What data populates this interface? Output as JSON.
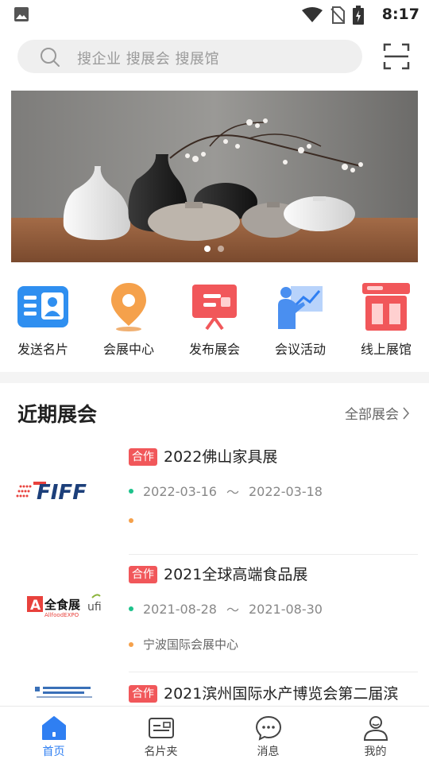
{
  "status_bar": {
    "time": "8:17"
  },
  "search": {
    "placeholder": "搜企业 搜展会 搜展馆"
  },
  "banner": {
    "slide_count": 2,
    "active_slide": 1
  },
  "quick_menu": [
    {
      "label": "发送名片",
      "icon": "business-card-icon",
      "color": "#2f8ff0"
    },
    {
      "label": "会展中心",
      "icon": "location-pin-icon",
      "color": "#f5a14b"
    },
    {
      "label": "发布展会",
      "icon": "publish-board-icon",
      "color": "#f1575a"
    },
    {
      "label": "会议活动",
      "icon": "presentation-icon",
      "color": "#4a8ff0"
    },
    {
      "label": "线上展馆",
      "icon": "online-hall-icon",
      "color": "#f1575a"
    }
  ],
  "section": {
    "title": "近期展会",
    "more": "全部展会"
  },
  "expos": [
    {
      "tag": "合作",
      "name": "2022佛山家具展",
      "start": "2022-03-16",
      "sep": "～",
      "end": "2022-03-18",
      "venue": "",
      "logo_text": "FIFF"
    },
    {
      "tag": "合作",
      "name": "2021全球高端食品展",
      "start": "2021-08-28",
      "sep": "～",
      "end": "2021-08-30",
      "venue": "宁波国际会展中心",
      "logo_text": "全食展",
      "logo_sub": "AllfoodEXPO",
      "logo_side": "ufi"
    },
    {
      "tag": "合作",
      "name": "2021滨州国际水产博览会第二届滨",
      "start": "",
      "sep": "",
      "end": "",
      "venue": "",
      "logo_text": ""
    }
  ],
  "tabs": [
    {
      "label": "首页",
      "icon": "home-icon",
      "active": true
    },
    {
      "label": "名片夹",
      "icon": "card-holder-icon",
      "active": false
    },
    {
      "label": "消息",
      "icon": "message-icon",
      "active": false
    },
    {
      "label": "我的",
      "icon": "user-icon",
      "active": false
    }
  ],
  "colors": {
    "accent": "#2f7ff2",
    "tag": "#f1575a",
    "date_dot": "#1dc28b",
    "venue_dot": "#f5a14b"
  }
}
